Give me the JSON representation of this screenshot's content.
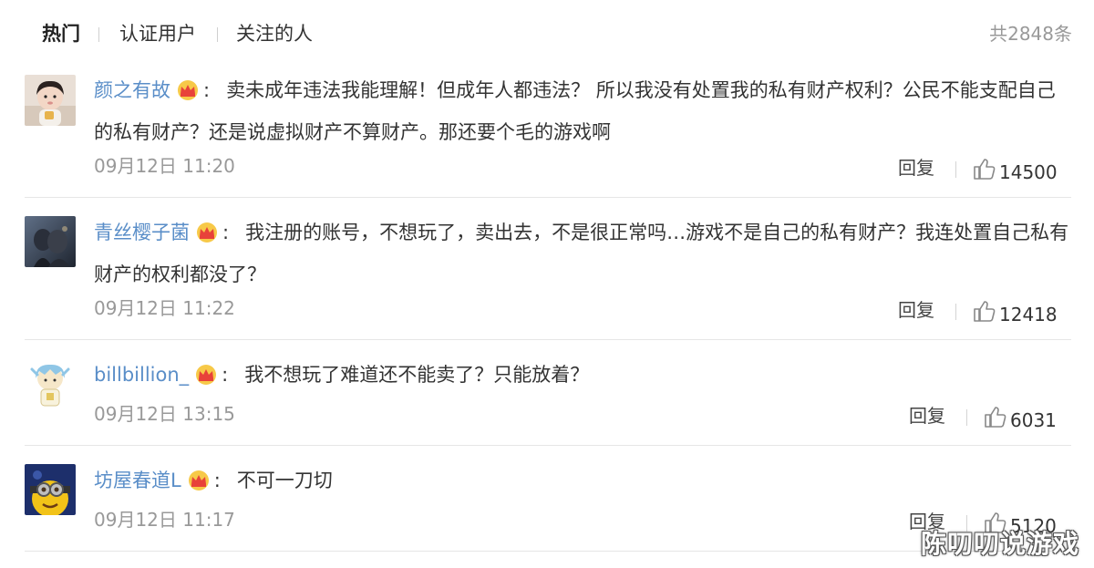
{
  "tabs": [
    {
      "label": "热门",
      "active": true
    },
    {
      "label": "认证用户",
      "active": false
    },
    {
      "label": "关注的人",
      "active": false
    }
  ],
  "total": "共2848条",
  "comments": [
    {
      "user": "颜之有故",
      "text": "卖未成年违法我能理解！但成年人都违法？ 所以我没有处置我的私有财产权利？公民不能支配自己的私有财产？还是说虚拟财产不算财产。那还要个毛的游戏啊",
      "time": "09月12日 11:20",
      "reply": "回复",
      "likes": "14500"
    },
    {
      "user": "青丝樱子菌",
      "text": "我注册的账号，不想玩了，卖出去，不是很正常吗…游戏不是自己的私有财产？我连处置自己私有财产的权利都没了？",
      "time": "09月12日 11:22",
      "reply": "回复",
      "likes": "12418"
    },
    {
      "user": "billbillion_",
      "text": "我不想玩了难道还不能卖了？只能放着？",
      "time": "09月12日 13:15",
      "reply": "回复",
      "likes": "6031"
    },
    {
      "user": "坊屋春道L",
      "text": "不可一刀切",
      "time": "09月12日 11:17",
      "reply": "回复",
      "likes": "5120"
    }
  ],
  "watermark": "陈叨叨说游戏",
  "colors": {
    "username": "#5a8ec8",
    "muted": "#999999",
    "divider": "#e6e6e6"
  }
}
